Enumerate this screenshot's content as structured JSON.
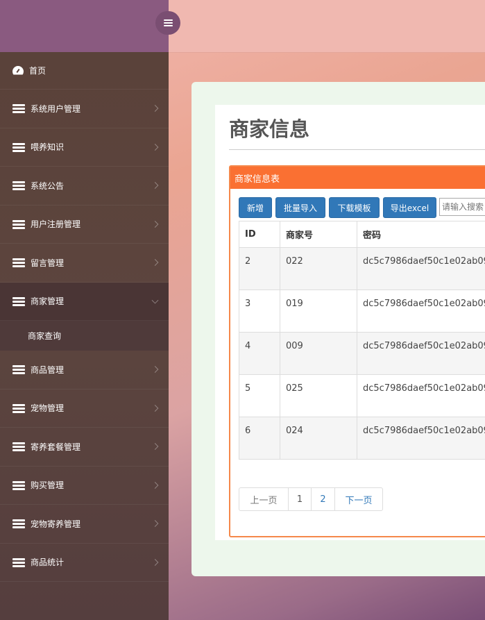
{
  "sidebar": {
    "items": [
      {
        "label": "首页",
        "icon": "dashboard-icon"
      },
      {
        "label": "系统用户管理",
        "icon": "list-icon"
      },
      {
        "label": "喂养知识",
        "icon": "list-icon"
      },
      {
        "label": "系统公告",
        "icon": "list-icon"
      },
      {
        "label": "用户注册管理",
        "icon": "list-icon"
      },
      {
        "label": "留言管理",
        "icon": "list-icon"
      },
      {
        "label": "商家管理",
        "icon": "list-icon",
        "expanded": true
      },
      {
        "label": "商品管理",
        "icon": "list-icon"
      },
      {
        "label": "宠物管理",
        "icon": "list-icon"
      },
      {
        "label": "寄养套餐管理",
        "icon": "list-icon"
      },
      {
        "label": "购买管理",
        "icon": "list-icon"
      },
      {
        "label": "宠物寄养管理",
        "icon": "list-icon"
      },
      {
        "label": "商品统计",
        "icon": "list-icon"
      }
    ],
    "submenu": [
      {
        "label": "商家查询"
      }
    ]
  },
  "main": {
    "title": "商家信息",
    "card_title": "商家信息表",
    "toolbar": {
      "add_label": "新增",
      "import_label": "批量导入",
      "template_label": "下载模板",
      "export_label": "导出excel",
      "search_placeholder": "请输入搜索"
    },
    "table": {
      "headers": [
        "ID",
        "商家号",
        "密码"
      ],
      "rows": [
        [
          "2",
          "022",
          "dc5c7986daef50c1e02ab09"
        ],
        [
          "3",
          "019",
          "dc5c7986daef50c1e02ab09"
        ],
        [
          "4",
          "009",
          "dc5c7986daef50c1e02ab09"
        ],
        [
          "5",
          "025",
          "dc5c7986daef50c1e02ab09"
        ],
        [
          "6",
          "024",
          "dc5c7986daef50c1e02ab09"
        ]
      ]
    },
    "pagination": {
      "prev": "上一页",
      "pages": [
        "1",
        "2"
      ],
      "next": "下一页"
    }
  },
  "colors": {
    "sidebar_top": "#8a5a80",
    "sidebar_bg": "#5a4139",
    "card_header": "#fa7032",
    "button": "#3178b8"
  }
}
